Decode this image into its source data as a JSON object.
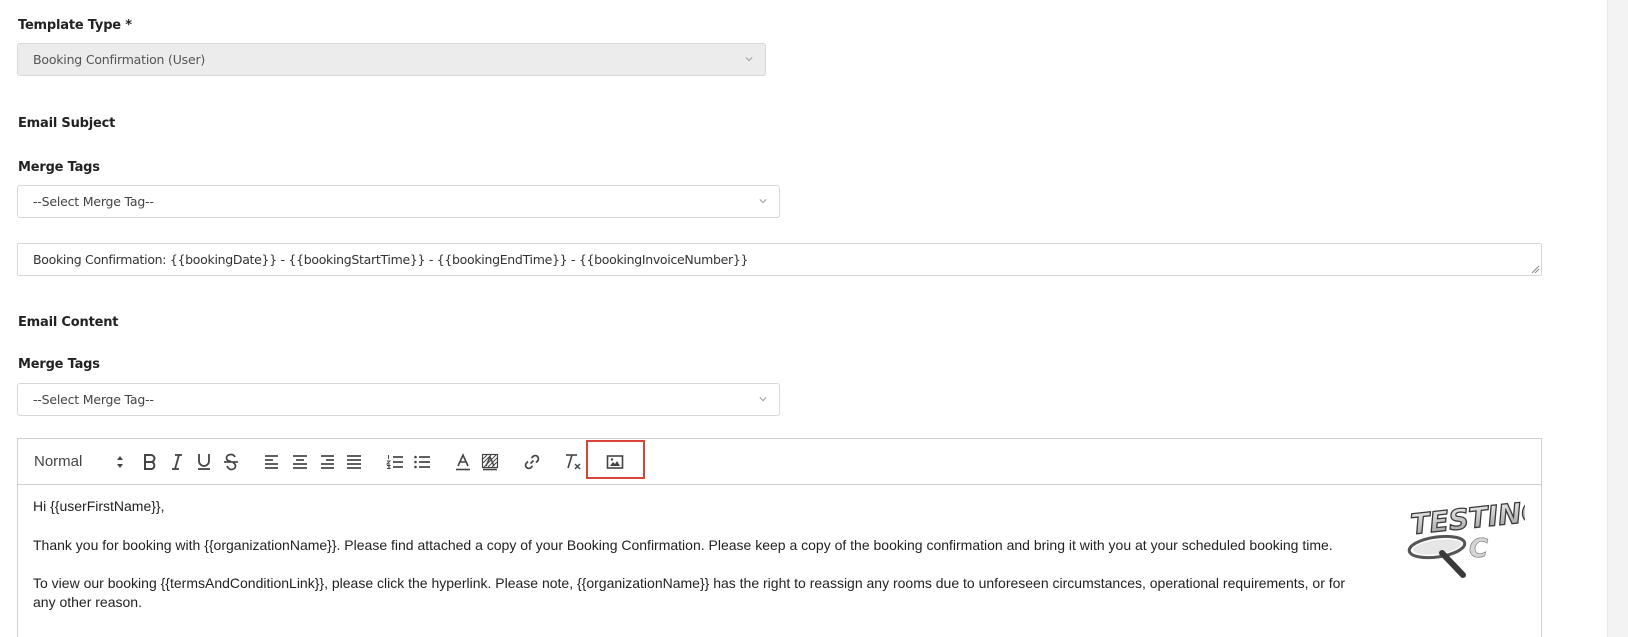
{
  "template_type": {
    "label": "Template Type *",
    "value": "Booking Confirmation (User)"
  },
  "email_subject": {
    "label": "Email Subject",
    "merge_tags_label": "Merge Tags",
    "merge_tags_placeholder": "--Select Merge Tag--",
    "subject_value": "Booking Confirmation: {{bookingDate}} - {{bookingStartTime}} - {{bookingEndTime}} - {{bookingInvoiceNumber}}"
  },
  "email_content": {
    "label": "Email Content",
    "merge_tags_label": "Merge Tags",
    "merge_tags_placeholder": "--Select Merge Tag--"
  },
  "toolbar": {
    "format_select": "Normal",
    "buttons": [
      "bold-icon",
      "italic-icon",
      "underline-icon",
      "strike-icon",
      "align-left-icon",
      "align-center-icon",
      "align-right-icon",
      "align-justify-icon",
      "ordered-list-icon",
      "bullet-list-icon",
      "text-color-icon",
      "background-color-icon",
      "link-icon",
      "clean-format-icon",
      "image-icon"
    ],
    "highlight_color": "#d9443a"
  },
  "editor": {
    "greeting": "Hi {{userFirstName}},",
    "paragraph_1": "Thank you for booking with {{organizationName}}. Please find attached a copy of your Booking Confirmation. Please keep a copy of the booking confirmation and bring it with you at your scheduled booking time.",
    "paragraph_2": "To view our booking {{termsAndConditionLink}}, please click the hyperlink. Please note, {{organizationName}} has the right to reassign any rooms due to unforeseen circumstances, operational requirements, or for any other reason.",
    "logo_text": "TESTING"
  }
}
